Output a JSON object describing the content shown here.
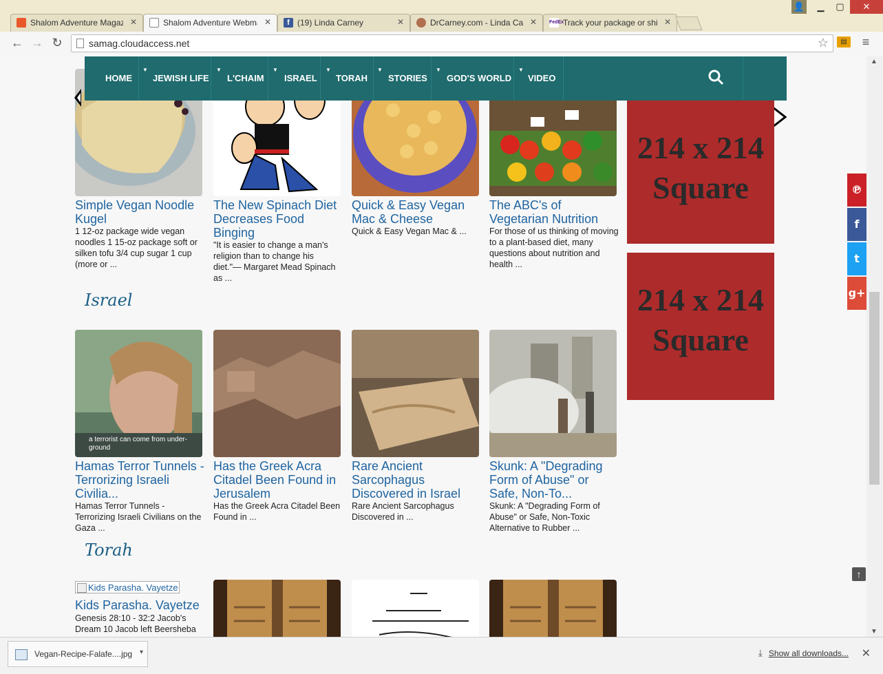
{
  "tabs": [
    {
      "label": "Shalom Adventure Magazine",
      "active": false,
      "favicon_color": "#e8582a"
    },
    {
      "label": "Shalom Adventure Webmail",
      "active": true,
      "favicon_color": "#ffffff"
    },
    {
      "label": "(19) Linda Carney",
      "active": false,
      "favicon_color": "#3b5998"
    },
    {
      "label": "DrCarney.com - Linda Carney",
      "active": false,
      "favicon_color": "#b07050"
    },
    {
      "label": "Track your package or shipment",
      "active": false,
      "favicon_color": "#4d148c"
    }
  ],
  "omnibox": {
    "url": "samag.cloudaccess.net"
  },
  "nav": {
    "items": [
      "HOME",
      "JEWISH LIFE",
      "L'CHAIM",
      "ISRAEL",
      "TORAH",
      "STORIES",
      "GOD'S WORLD",
      "VIDEO"
    ]
  },
  "top_cards": [
    {
      "title": "Simple Vegan Noodle Kugel",
      "desc": "1 12-oz package wide vegan noodles 1 15-oz package soft or silken tofu 3/4 cup sugar 1 cup (more or ..."
    },
    {
      "title": "The New Spinach Diet Decreases Food Binging",
      "desc": "\"It is easier to change a man's religion than to change his diet.\"— Margaret Mead Spinach as ..."
    },
    {
      "title": "Quick & Easy Vegan Mac & Cheese",
      "desc": "Quick & Easy Vegan Mac & ..."
    },
    {
      "title": "The ABC's of Vegetarian Nutrition",
      "desc": "For those of us thinking of moving to a plant-based diet, many questions about nutrition and health ..."
    }
  ],
  "sections": {
    "israel": "Israel",
    "torah": "Torah"
  },
  "israel_cards": [
    {
      "title": "Hamas Terror Tunnels - Terrorizing Israeli Civilia...",
      "desc": "Hamas Terror Tunnels - Terrorizing Israeli Civilians on the Gaza ...",
      "caption": "a terrorist can come from under-ground"
    },
    {
      "title": "Has the Greek Acra Citadel Been Found in Jerusalem",
      "desc": "Has the Greek Acra Citadel Been Found in ..."
    },
    {
      "title": "Rare Ancient Sarcophagus Discovered in Israel",
      "desc": "Rare Ancient Sarcophagus Discovered in ..."
    },
    {
      "title": "Skunk: A \"Degrading Form of Abuse\" or Safe, Non-To...",
      "desc": "Skunk: A \"Degrading Form of Abuse\" or Safe, Non-Toxic Alternative to Rubber ..."
    }
  ],
  "torah_cards": [
    {
      "title": "Kids Parasha. Vayetze",
      "alt": "Kids Parasha. Vayetze",
      "desc": "Genesis 28:10 - 32:2 Jacob's Dream 10 Jacob left Beersheba"
    }
  ],
  "ads": [
    {
      "line1": "214 x 214",
      "line2": "Square"
    },
    {
      "line1": "214 x 214",
      "line2": "Square"
    }
  ],
  "share": [
    {
      "icon": "pinterest-icon",
      "glyph": "℗",
      "color": "#cb2027"
    },
    {
      "icon": "facebook-icon",
      "glyph": "f",
      "color": "#3b5998"
    },
    {
      "icon": "twitter-icon",
      "glyph": "t",
      "color": "#1da1f2"
    },
    {
      "icon": "googleplus-icon",
      "glyph": "g+",
      "color": "#dd4b39"
    }
  ],
  "download": {
    "filename": "Vegan-Recipe-Falafe....jpg",
    "show_all": "Show all downloads..."
  }
}
